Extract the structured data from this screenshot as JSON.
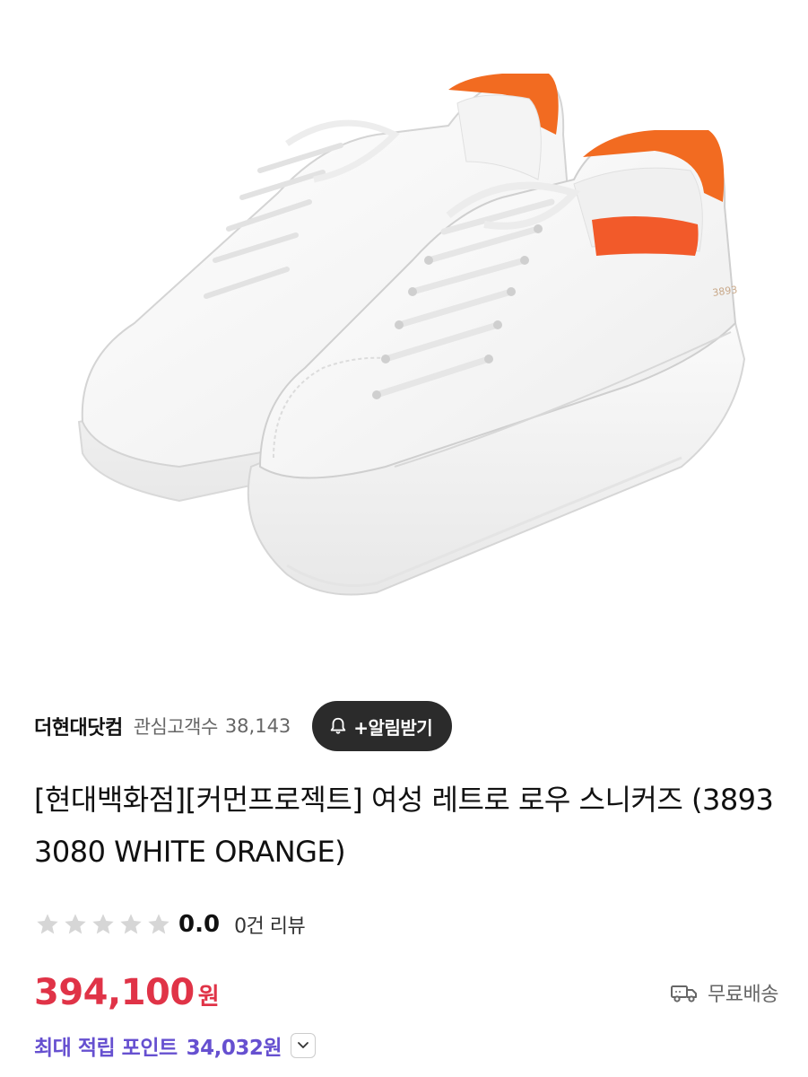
{
  "product_image": {
    "alt": "",
    "model_stamp": "3893"
  },
  "store": {
    "name": "더현대닷컴",
    "follower_label": "관심고객수",
    "follower_count": "38,143",
    "alert_button_label": "+알림받기"
  },
  "product": {
    "title": "[현대백화점][커먼프로젝트] 여성 레트로 로우 스니커즈 (3893 3080 WHITE ORANGE)"
  },
  "rating": {
    "stars_filled": 0,
    "stars_total": 5,
    "value": "0.0",
    "review_count": "0건 리뷰"
  },
  "price": {
    "amount": "394,100",
    "unit": "원"
  },
  "delivery": {
    "label": "무료배송",
    "icon": "truck-icon"
  },
  "points": {
    "label": "최대 적립 포인트",
    "value": "34,032원"
  },
  "colors": {
    "price": "#e03347",
    "points": "#6650d0",
    "button_bg": "#2b2b2b",
    "star_empty": "#d6d6d6",
    "heel_accent": "#f26b21"
  }
}
